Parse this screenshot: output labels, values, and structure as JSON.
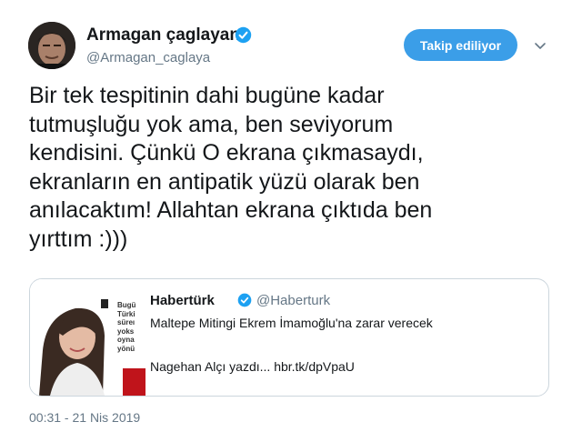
{
  "tweet": {
    "author": {
      "display_name": "Armagan çaglayan",
      "handle": "@Armagan_caglaya",
      "verified_icon": "verified-badge-icon",
      "avatar_icon": "profile-photo"
    },
    "follow_button_label": "Takip ediliyor",
    "menu_icon": "chevron-down-icon",
    "text": "Bir tek tespitinin dahi bugüne kadar\ntutmuşluğu yok ama,  ben seviyorum\nkendisini. Çünkü O ekrana çıkmasaydı,\nekranların en antipatik yüzü olarak ben\nanılacaktım! Allahtan ekrana çıktıda ben\nyırttım :)))",
    "timestamp": "00:31 - 21 Nis 2019"
  },
  "quote": {
    "author_name": "Habertürk",
    "author_handle": "@Haberturk",
    "line1": "Maltepe Mitingi Ekrem İmamoğlu'na zarar verecek",
    "line2": "Nagehan Alçı yazdı... hbr.tk/dpVpaU",
    "thumbnail_text": [
      "Bugü",
      "Türki",
      "süreı",
      "yoks",
      "oyna",
      "yönü"
    ]
  },
  "colors": {
    "accent_blue": "#1da1f2",
    "button_blue": "#3b9ee8",
    "secondary_text": "#657786",
    "border": "#ccd6dd",
    "thumbnail_red": "#c0141b"
  }
}
